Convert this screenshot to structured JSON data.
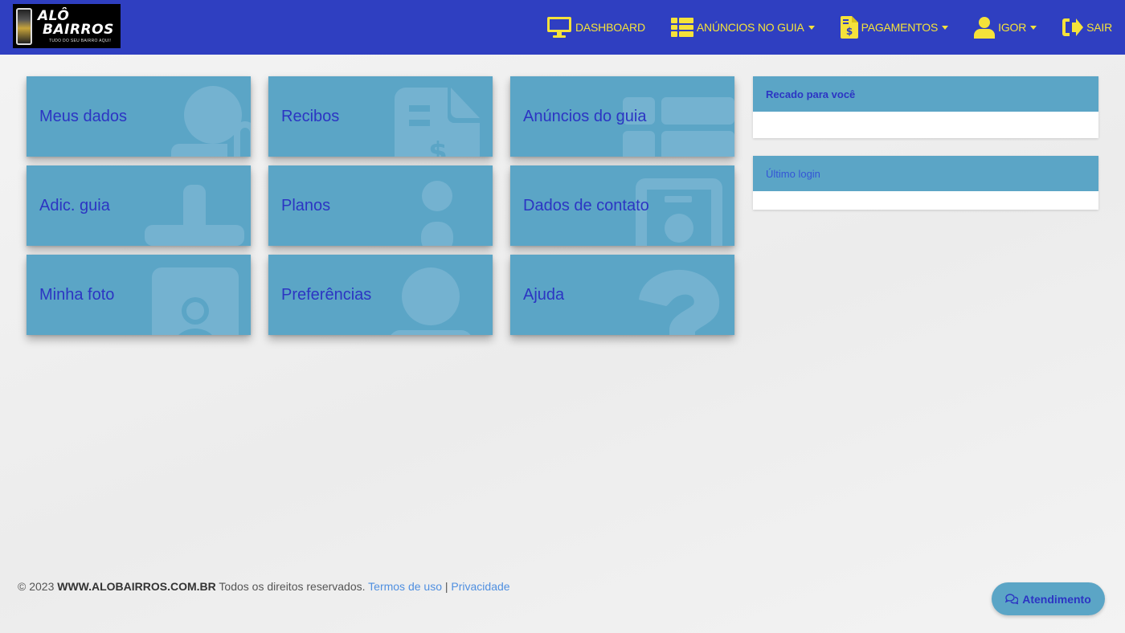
{
  "brand": {
    "logo_line1": "ALÔ",
    "logo_line2": "BAIRROS",
    "logo_tagline": "TUDO DO SEU BAIRRO AQUI!"
  },
  "nav": {
    "dashboard": "DASHBOARD",
    "anuncios": "ANÚNCIOS NO GUIA",
    "pagamentos": "PAGAMENTOS",
    "user": "IGOR",
    "sair": "SAIR"
  },
  "tiles": [
    {
      "label": "Meus dados",
      "icon": "user-lock-icon"
    },
    {
      "label": "Recibos",
      "icon": "invoice-dollar-icon"
    },
    {
      "label": "Anúncios do guia",
      "icon": "th-list-icon"
    },
    {
      "label": "Adic. guia",
      "icon": "plus-icon"
    },
    {
      "label": "Planos",
      "icon": "info-icon"
    },
    {
      "label": "Dados de contato",
      "icon": "address-book-icon"
    },
    {
      "label": "Minha foto",
      "icon": "portrait-icon"
    },
    {
      "label": "Preferências",
      "icon": "user-cog-icon"
    },
    {
      "label": "Ajuda",
      "icon": "question-icon"
    }
  ],
  "cards": {
    "recado_title": "Recado para você",
    "ultimo_login_title": "Último login"
  },
  "footer": {
    "copyright": "© 2023",
    "site": "WWW.ALOBAIRROS.COM.BR",
    "rights": "Todos os direitos reservados.",
    "terms": "Termos de uso",
    "separator": "|",
    "privacy": "Privacidade"
  },
  "support": {
    "label": "Atendimento"
  },
  "colors": {
    "header_bg": "#2f3fc1",
    "nav_text": "#f5e23a",
    "tile_bg": "#5ba5c6",
    "tile_text": "#2c35c3",
    "link": "#4f8fe0"
  }
}
